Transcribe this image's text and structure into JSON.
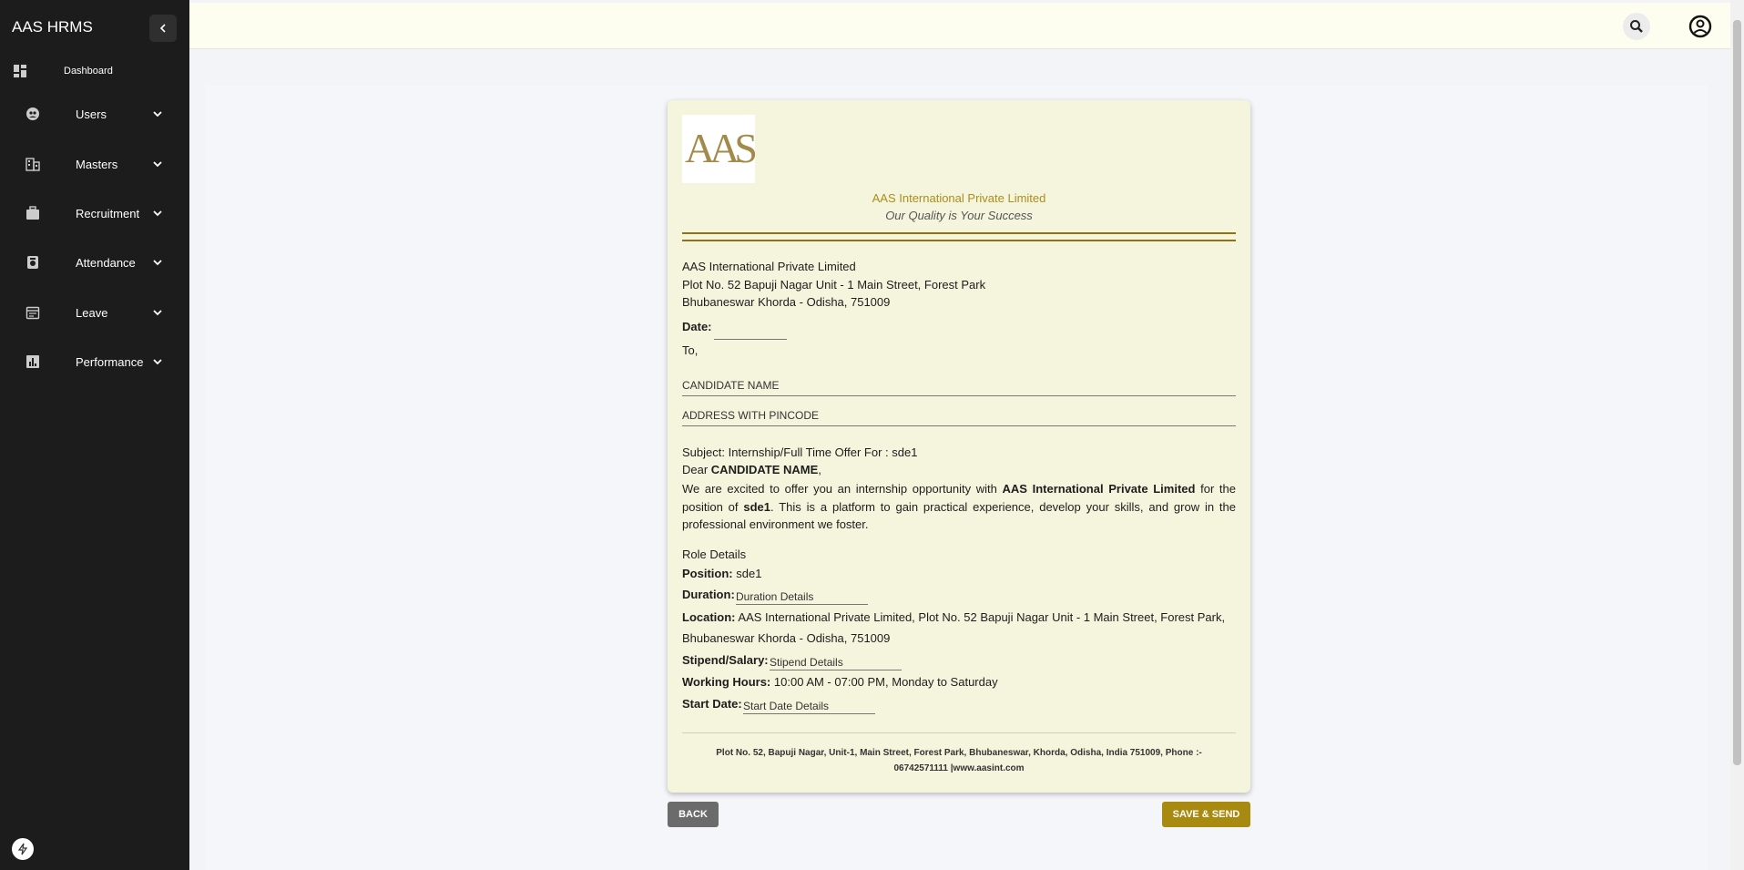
{
  "app": {
    "title": "AAS HRMS"
  },
  "sidebar": {
    "items": [
      {
        "label": "Dashboard",
        "icon": "dashboard-icon"
      },
      {
        "label": "Users",
        "icon": "users-icon"
      },
      {
        "label": "Masters",
        "icon": "building-icon"
      },
      {
        "label": "Recruitment",
        "icon": "briefcase-icon"
      },
      {
        "label": "Attendance",
        "icon": "attendance-icon"
      },
      {
        "label": "Leave",
        "icon": "calendar-icon"
      },
      {
        "label": "Performance",
        "icon": "chart-icon"
      }
    ]
  },
  "letter": {
    "logo_text": "AAS",
    "company_name": "AAS International Private Limited",
    "tagline": "Our Quality is Your Success",
    "address_lines": [
      "AAS International Private Limited",
      "Plot No. 52 Bapuji Nagar Unit - 1 Main Street, Forest Park",
      "Bhubaneswar Khorda - Odisha, 751009"
    ],
    "date_label": "Date:",
    "to_label": "To,",
    "candidate_placeholder": "CANDIDATE NAME",
    "address_placeholder": "ADDRESS WITH PINCODE",
    "subject": "Subject: Internship/Full Time Offer For : sde1",
    "dear_prefix": "Dear ",
    "dear_name": "CANDIDATE NAME",
    "dear_suffix": ",",
    "body_1": "We are excited to offer you an internship opportunity with ",
    "body_company": "AAS International Private Limited",
    "body_2": " for the position of ",
    "body_position": "sde1",
    "body_3": ". This is a platform to gain practical experience, develop your skills, and grow in the professional environment we foster.",
    "role_details_title": "Role Details",
    "position_label": "Position:",
    "position_value": "sde1",
    "duration_label": "Duration:",
    "duration_value": "Duration Details",
    "location_label": "Location:",
    "location_value_1": "AAS International Private Limited, Plot No. 52 Bapuji Nagar Unit - 1 Main Street, Forest Park,",
    "location_value_2": "Bhubaneswar Khorda - Odisha, 751009",
    "stipend_label": "Stipend/Salary:",
    "stipend_value": "Stipend Details",
    "hours_label": "Working Hours:",
    "hours_value": "10:00 AM - 07:00 PM, Monday to Saturday",
    "start_label": "Start Date:",
    "start_value": "Start Date Details",
    "footer_1": "Plot No. 52, Bapuji Nagar, Unit-1, Main Street, Forest Park, Bhubaneswar, Khorda, Odisha, India 751009, Phone :-",
    "footer_2": "06742571111 |www.aasint.com"
  },
  "actions": {
    "back_label": "BACK",
    "save_label": "SAVE & SEND"
  },
  "colors": {
    "sidebar": "#1c1c1c",
    "topbar": "#fefef0",
    "letter_bg": "#f5f4dc",
    "accent_gold": "#a98a10"
  }
}
